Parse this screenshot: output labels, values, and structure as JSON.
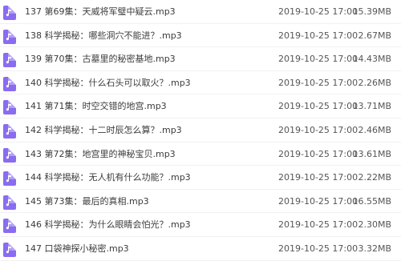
{
  "file_list": {
    "icon_name": "audio-file-icon",
    "icon_color": "#8a6cf0",
    "rows": [
      {
        "name": "137 第69集：天威将军璧中疑云.mp3",
        "date": "2019-10-25 17:00",
        "size": "15.39MB"
      },
      {
        "name": "138 科学揭秘：哪些洞穴不能进？.mp3",
        "date": "2019-10-25 17:00",
        "size": "2.67MB"
      },
      {
        "name": "139 第70集：古墓里的秘密基地.mp3",
        "date": "2019-10-25 17:00",
        "size": "14.43MB"
      },
      {
        "name": "140 科学揭秘：什么石头可以取火？.mp3",
        "date": "2019-10-25 17:00",
        "size": "2.26MB"
      },
      {
        "name": "141 第71集：时空交错的地宫.mp3",
        "date": "2019-10-25 17:00",
        "size": "13.71MB"
      },
      {
        "name": "142 科学揭秘：十二时辰怎么算？.mp3",
        "date": "2019-10-25 17:00",
        "size": "2.46MB"
      },
      {
        "name": "143 第72集：地宫里的神秘宝贝.mp3",
        "date": "2019-10-25 17:00",
        "size": "13.61MB"
      },
      {
        "name": "144 科学揭秘：无人机有什么功能？.mp3",
        "date": "2019-10-25 17:00",
        "size": "2.22MB"
      },
      {
        "name": "145 第73集：最后的真相.mp3",
        "date": "2019-10-25 17:00",
        "size": "16.55MB"
      },
      {
        "name": "146 科学揭秘：为什么眼睛会怕光？.mp3",
        "date": "2019-10-25 17:00",
        "size": "2.30MB"
      },
      {
        "name": "147 口袋神探小秘密.mp3",
        "date": "2019-10-25 17:00",
        "size": "3.32MB"
      }
    ]
  }
}
